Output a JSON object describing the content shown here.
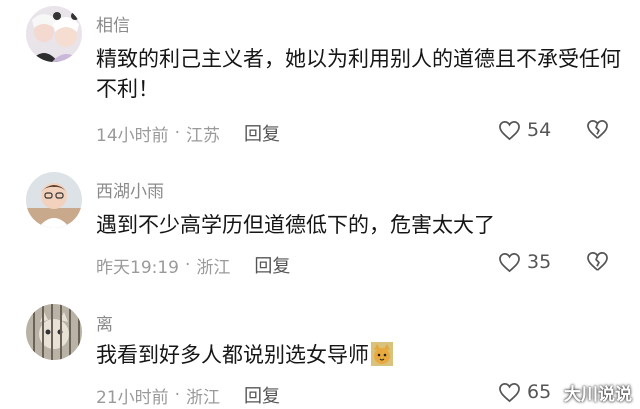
{
  "comments": [
    {
      "username": "相信",
      "text": "精致的利己主义者，她以为利用别人的道德且不承受任何不利！",
      "time": "14小时前",
      "location": "江苏",
      "reply_label": "回复",
      "likes": "54",
      "avatar_icon": "two-person-photo-avatar"
    },
    {
      "username": "西湖小雨",
      "text": "遇到不少高学历但道德低下的，危害太大了",
      "time": "昨天19:19",
      "location": "浙江",
      "reply_label": "回复",
      "likes": "35",
      "avatar_icon": "child-photo-avatar"
    },
    {
      "username": "离",
      "text": "我看到好多人都说别选女导师",
      "time": "21小时前",
      "location": "浙江",
      "reply_label": "回复",
      "likes": "65",
      "avatar_icon": "caged-cat-avatar",
      "inline_emoji": "cat-emoji"
    }
  ],
  "separator": "·",
  "watermark": "大川说说",
  "colors": {
    "text": "#161616",
    "meta": "#9a9a9a",
    "icon": "#555555"
  }
}
